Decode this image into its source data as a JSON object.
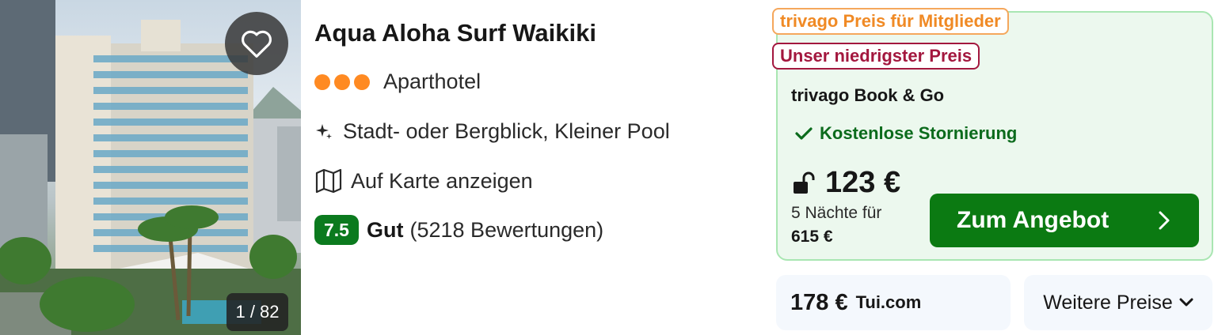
{
  "hotel": {
    "name": "Aqua Aloha Surf Waikiki",
    "stars": 3,
    "type": "Aparthotel",
    "features": "Stadt- oder Bergblick, Kleiner Pool",
    "map_link": "Auf Karte anzeigen",
    "rating_score": "7.5",
    "rating_label": "Gut",
    "review_count": "(5218 Bewertungen)",
    "photo_counter": "1 / 82",
    "icons": {
      "favorite": "heart-outline-icon",
      "features": "sparkle-icon",
      "map": "map-icon"
    }
  },
  "offer": {
    "tag_member": "trivago Preis für Mitglieder",
    "tag_lowest": "Unser niedrigster Preis",
    "partner": "trivago Book & Go",
    "cancellation": "Kostenlose Stornierung",
    "price": "123 €",
    "nights_label": "5 Nächte für",
    "total": "615 €",
    "cta_label": "Zum Angebot",
    "icons": {
      "lock": "unlock-icon",
      "check": "checkmark-icon",
      "cta": "chevron-right-icon"
    }
  },
  "alt_offer": {
    "price": "178 €",
    "site": "Tui.com"
  },
  "more_prices": {
    "label": "Weitere Preise",
    "icon": "chevron-down-icon"
  },
  "colors": {
    "brand_green": "#0b7a12",
    "rating_green": "#0b7a1e",
    "member_orange": "#f08a25",
    "lowest_red": "#a3173e",
    "offer_bg": "#ecf8ee",
    "star_orange": "#ff8a22"
  }
}
